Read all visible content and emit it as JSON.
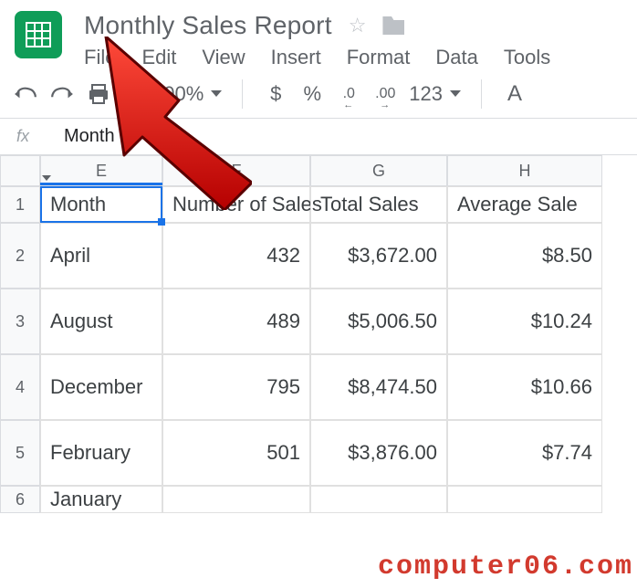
{
  "doc": {
    "title": "Monthly Sales Report"
  },
  "menu": {
    "file": "File",
    "edit": "Edit",
    "view": "View",
    "insert": "Insert",
    "format": "Format",
    "data": "Data",
    "tools": "Tools"
  },
  "toolbar": {
    "zoom": "100%",
    "currency": "$",
    "percent": "%",
    "dec_decrease": ".0",
    "dec_increase": ".00",
    "num_format": "123",
    "font_sample": "A"
  },
  "formula": {
    "label": "fx",
    "value": "Month"
  },
  "columns": {
    "E": "E",
    "F": "F",
    "G": "G",
    "H": "H"
  },
  "rows": [
    "1",
    "2",
    "3",
    "4",
    "5",
    "6"
  ],
  "headers": {
    "month": "Month",
    "num_sales": "Number of Sales",
    "total_sales": "Total Sales",
    "avg_sale": "Average Sale"
  },
  "data_rows": [
    {
      "month": "April",
      "num": "432",
      "total": "$3,672.00",
      "avg": "$8.50"
    },
    {
      "month": "August",
      "num": "489",
      "total": "$5,006.50",
      "avg": "$10.24"
    },
    {
      "month": "December",
      "num": "795",
      "total": "$8,474.50",
      "avg": "$10.66"
    },
    {
      "month": "February",
      "num": "501",
      "total": "$3,876.00",
      "avg": "$7.74"
    },
    {
      "month": "January",
      "num": "",
      "total": "",
      "avg": ""
    }
  ],
  "watermark": "computer06.com"
}
